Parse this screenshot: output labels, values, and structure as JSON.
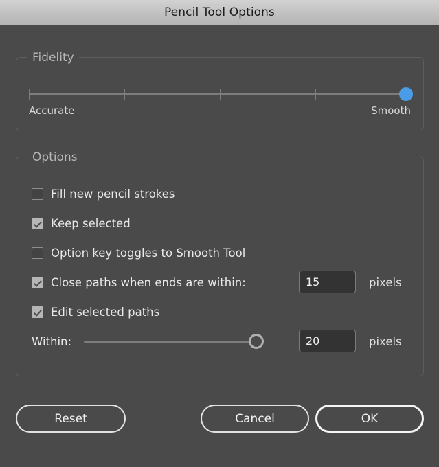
{
  "window": {
    "title": "Pencil Tool Options"
  },
  "fidelity": {
    "legend": "Fidelity",
    "min_label": "Accurate",
    "max_label": "Smooth",
    "value_percent": 100,
    "tick_percents": [
      0,
      25,
      50,
      75,
      100
    ],
    "handle_color": "#4a9ce8"
  },
  "options": {
    "legend": "Options",
    "checkboxes": [
      {
        "label": "Fill new pencil strokes",
        "checked": false
      },
      {
        "label": "Keep selected",
        "checked": true
      },
      {
        "label": "Option key toggles to Smooth Tool",
        "checked": false
      },
      {
        "label": "Close paths when ends are within:",
        "checked": true
      },
      {
        "label": "Edit selected paths",
        "checked": true
      }
    ],
    "close_paths_value": "15",
    "close_paths_units": "pixels",
    "within_label": "Within:",
    "within_value": "20",
    "within_units": "pixels",
    "within_slider_percent": 92
  },
  "buttons": {
    "reset": "Reset",
    "cancel": "Cancel",
    "ok": "OK"
  },
  "colors": {
    "background": "#4a4a4a",
    "titlebar": "#c4c4c4",
    "accent": "#4a9ce8",
    "text": "#e9e9e9"
  }
}
